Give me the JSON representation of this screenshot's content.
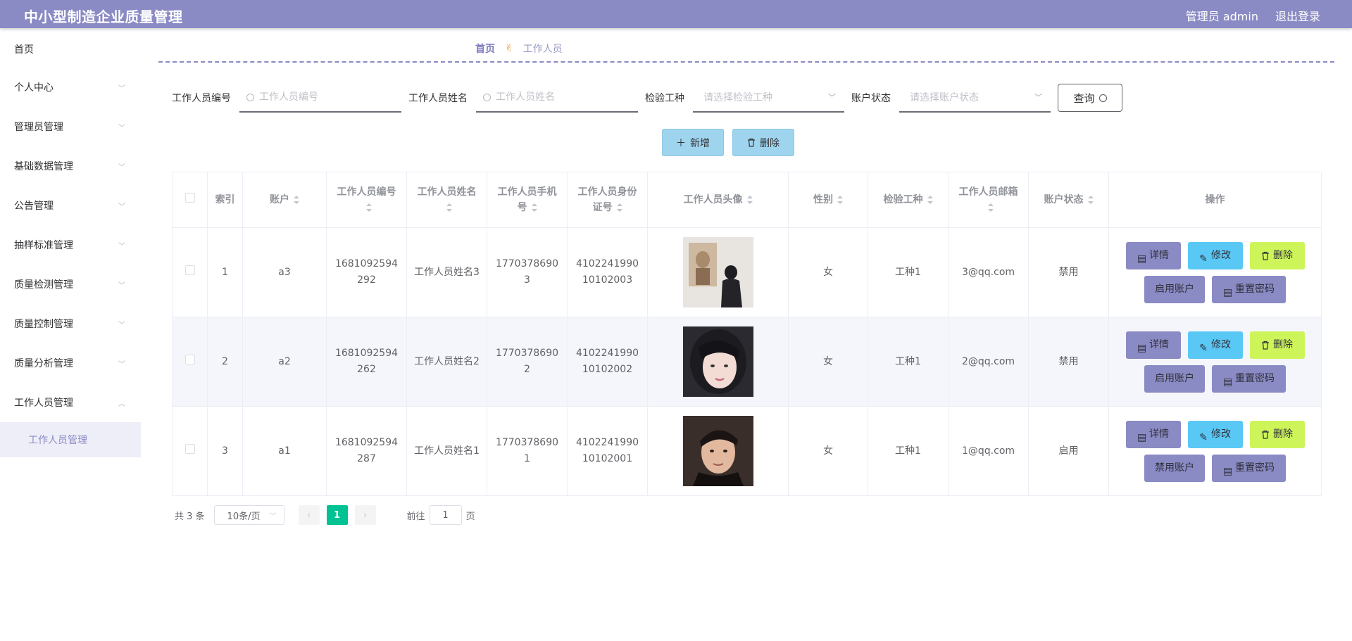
{
  "header": {
    "title": "中小型制造企业质量管理",
    "user_label": "管理员 admin",
    "logout_label": "退出登录",
    "bg_color": "#8a8ac4"
  },
  "sidebar": {
    "items": [
      {
        "label": "首页",
        "icon": ""
      },
      {
        "label": "个人中心",
        "icon": "chevron-down-icon"
      },
      {
        "label": "管理员管理",
        "icon": "chevron-down-icon"
      },
      {
        "label": "基础数据管理",
        "icon": "chevron-down-icon"
      },
      {
        "label": "公告管理",
        "icon": "chevron-down-icon"
      },
      {
        "label": "抽样标准管理",
        "icon": "chevron-down-icon"
      },
      {
        "label": "质量检测管理",
        "icon": "chevron-down-icon"
      },
      {
        "label": "质量控制管理",
        "icon": "chevron-down-icon"
      },
      {
        "label": "质量分析管理",
        "icon": "chevron-down-icon"
      },
      {
        "label": "工作人员管理",
        "icon": "chevron-up-icon"
      }
    ],
    "sub_item": "工作人员管理"
  },
  "breadcrumb": {
    "home": "首页",
    "current": "工作人员"
  },
  "search": {
    "id_label": "工作人员编号",
    "id_placeholder": "工作人员编号",
    "name_label": "工作人员姓名",
    "name_placeholder": "工作人员姓名",
    "type_label": "检验工种",
    "type_placeholder": "请选择检验工种",
    "status_label": "账户状态",
    "status_placeholder": "请选择账户状态",
    "query_label": "查询"
  },
  "actions": {
    "add_label": "新增",
    "delete_label": "删除"
  },
  "table": {
    "headers": {
      "index": "索引",
      "account": "账户",
      "id": "工作人员编号",
      "name": "工作人员姓名",
      "phone": "工作人员手机号",
      "idcard": "工作人员身份证号",
      "avatar": "工作人员头像",
      "gender": "性别",
      "type": "检验工种",
      "email": "工作人员邮箱",
      "status": "账户状态",
      "ops": "操作"
    },
    "rows": [
      {
        "index": "1",
        "account": "a3",
        "id": "1681092594292",
        "name": "工作人员姓名3",
        "phone": "17703786903",
        "idcard": "410224199010102003",
        "gender": "女",
        "type": "工种1",
        "email": "3@qq.com",
        "status": "禁用",
        "toggle_label": "启用账户"
      },
      {
        "index": "2",
        "account": "a2",
        "id": "1681092594262",
        "name": "工作人员姓名2",
        "phone": "17703786902",
        "idcard": "410224199010102002",
        "gender": "女",
        "type": "工种1",
        "email": "2@qq.com",
        "status": "禁用",
        "toggle_label": "启用账户"
      },
      {
        "index": "3",
        "account": "a1",
        "id": "1681092594287",
        "name": "工作人员姓名1",
        "phone": "17703786901",
        "idcard": "410224199010102001",
        "gender": "女",
        "type": "工种1",
        "email": "1@qq.com",
        "status": "启用",
        "toggle_label": "禁用账户"
      }
    ],
    "op_labels": {
      "detail": "详情",
      "edit": "修改",
      "delete": "删除",
      "reset": "重置密码"
    }
  },
  "pager": {
    "total": "共 3 条",
    "size": "10条/页",
    "current_page": "1",
    "goto_prefix": "前往",
    "goto_value": "1",
    "goto_suffix": "页"
  },
  "colors": {
    "accent": "#8a8ac4",
    "info": "#5ac8f5",
    "lime": "#cdf55a",
    "pager_active": "#00c292"
  }
}
